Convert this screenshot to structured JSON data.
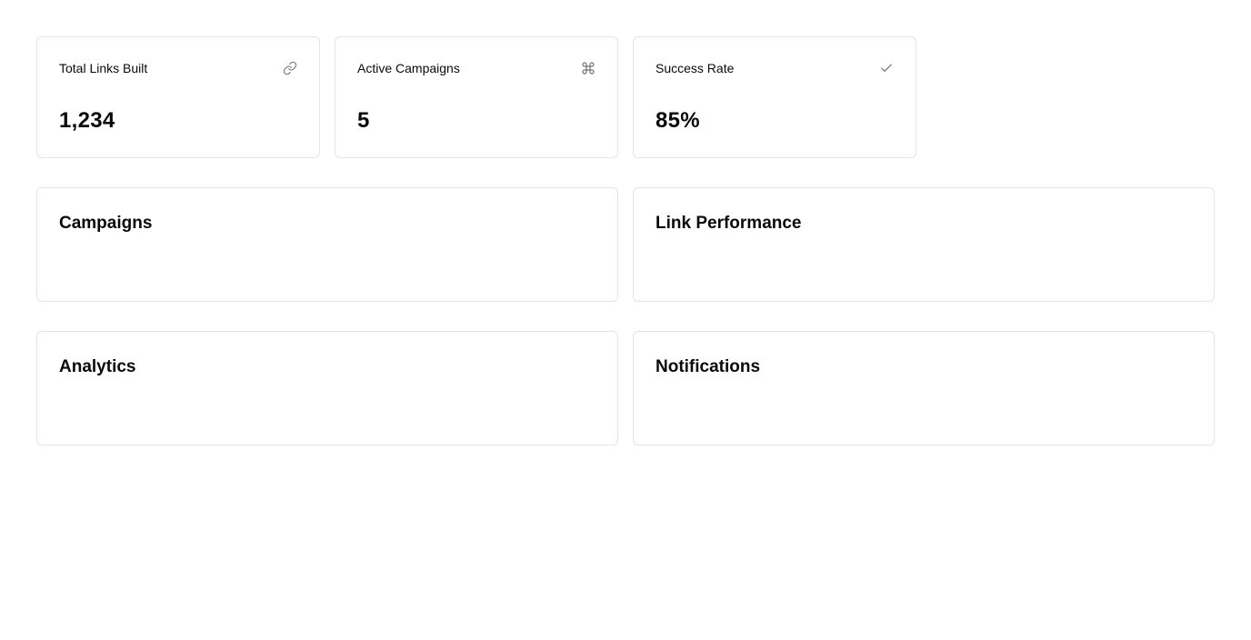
{
  "stats": [
    {
      "label": "Total Links Built",
      "value": "1,234",
      "icon": "link-icon"
    },
    {
      "label": "Active Campaigns",
      "value": "5",
      "icon": "command-icon"
    },
    {
      "label": "Success Rate",
      "value": "85%",
      "icon": "check-icon"
    }
  ],
  "sections": {
    "campaigns": {
      "title": "Campaigns"
    },
    "link_performance": {
      "title": "Link Performance"
    },
    "analytics": {
      "title": "Analytics"
    },
    "notifications": {
      "title": "Notifications"
    }
  },
  "colors": {
    "border": "#e4e4e7",
    "text": "#0a0a0a",
    "icon": "#71717a",
    "background": "#ffffff"
  }
}
